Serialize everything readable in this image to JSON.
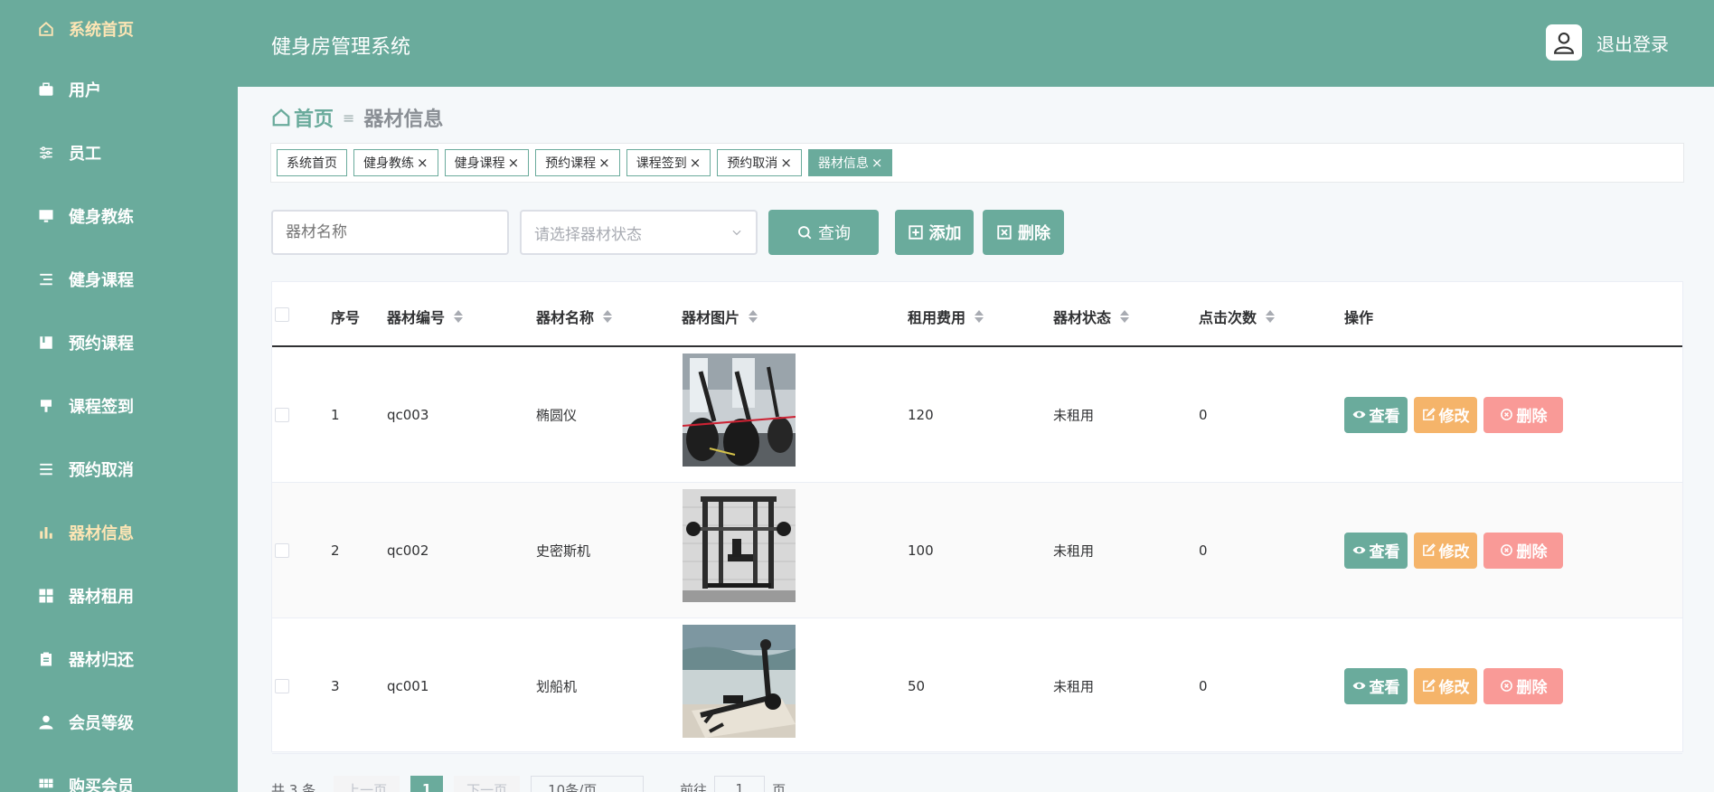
{
  "header": {
    "title": "健身房管理系统",
    "logout_label": "退出登录"
  },
  "sidebar": {
    "items": [
      {
        "label": "系统首页",
        "icon": "home-icon"
      },
      {
        "label": "用户",
        "icon": "briefcase-icon"
      },
      {
        "label": "员工",
        "icon": "sliders-icon"
      },
      {
        "label": "健身教练",
        "icon": "monitor-icon"
      },
      {
        "label": "健身课程",
        "icon": "list-icon"
      },
      {
        "label": "预约课程",
        "icon": "book-icon"
      },
      {
        "label": "课程签到",
        "icon": "stamp-icon"
      },
      {
        "label": "预约取消",
        "icon": "menu-icon"
      },
      {
        "label": "器材信息",
        "icon": "bar-chart-icon"
      },
      {
        "label": "器材租用",
        "icon": "grid-icon"
      },
      {
        "label": "器材归还",
        "icon": "clipboard-icon"
      },
      {
        "label": "会员等级",
        "icon": "user-icon"
      },
      {
        "label": "购买会员",
        "icon": "grid-icon"
      }
    ]
  },
  "breadcrumb": {
    "home": "首页",
    "current": "器材信息"
  },
  "tags": [
    {
      "label": "系统首页",
      "closable": false
    },
    {
      "label": "健身教练",
      "closable": true
    },
    {
      "label": "健身课程",
      "closable": true
    },
    {
      "label": "预约课程",
      "closable": true
    },
    {
      "label": "课程签到",
      "closable": true
    },
    {
      "label": "预约取消",
      "closable": true
    },
    {
      "label": "器材信息",
      "closable": true
    }
  ],
  "toolbar": {
    "name_placeholder": "器材名称",
    "status_placeholder": "请选择器材状态",
    "query_label": "查询",
    "add_label": "添加",
    "delete_label": "删除"
  },
  "table": {
    "columns": {
      "index": "序号",
      "code": "器材编号",
      "name": "器材名称",
      "image": "器材图片",
      "fee": "租用费用",
      "status": "器材状态",
      "clicks": "点击次数",
      "ops": "操作"
    },
    "rows": [
      {
        "index": "1",
        "code": "qc003",
        "name": "椭圆仪",
        "fee": "120",
        "status": "未租用",
        "clicks": "0"
      },
      {
        "index": "2",
        "code": "qc002",
        "name": "史密斯机",
        "fee": "100",
        "status": "未租用",
        "clicks": "0"
      },
      {
        "index": "3",
        "code": "qc001",
        "name": "划船机",
        "fee": "50",
        "status": "未租用",
        "clicks": "0"
      }
    ],
    "ops": {
      "view": "查看",
      "edit": "修改",
      "delete": "删除"
    }
  },
  "pager": {
    "total": "共 3 条",
    "prev": "上一页",
    "page": "1",
    "next": "下一页",
    "size": "10条/页",
    "goto_prefix": "前往",
    "goto_value": "1",
    "goto_suffix": "页"
  },
  "colors": {
    "primary": "#6aab9c",
    "edit": "#f5b46a",
    "danger": "#f99a97",
    "active_menu": "#fde5b4"
  }
}
